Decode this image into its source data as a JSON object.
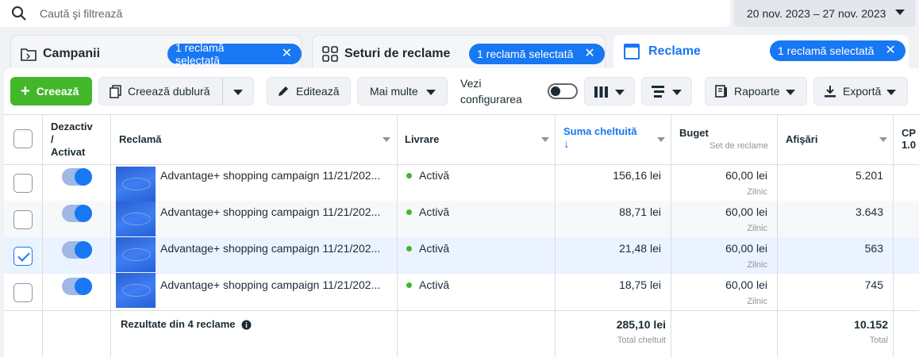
{
  "search": {
    "placeholder": "Caută şi filtrează"
  },
  "date_range": "20 nov. 2023 – 27 nov. 2023",
  "tabs": [
    {
      "label": "Campanii",
      "pill": "1 reclamă selectată"
    },
    {
      "label": "Seturi de reclame",
      "pill": "1 reclamă selectată"
    },
    {
      "label": "Reclame",
      "pill": "1 reclamă selectată"
    }
  ],
  "toolbar": {
    "create": "Creează",
    "duplicate": "Creează dublură",
    "edit": "Editează",
    "more": "Mai multe",
    "view_setup_line1": "Vezi",
    "view_setup_line2": "configurarea",
    "reports": "Rapoarte",
    "export": "Exportă"
  },
  "columns": {
    "status_l1": "Dezactiv",
    "status_l2": "/",
    "status_l3": "Activat",
    "ad": "Reclamă",
    "delivery": "Livrare",
    "spent": "Suma cheltuită",
    "spent_arrow": "↓",
    "budget": "Buget",
    "budget_sub": "Set de reclame",
    "impressions": "Afişări",
    "cpm_l1": "CP",
    "cpm_l2": "1.0"
  },
  "rows": [
    {
      "name": "Advantage+ shopping campaign 11/21/202...",
      "delivery": "Activă",
      "spent": "156,16 lei",
      "budget": "60,00 lei",
      "budget_period": "Zilnic",
      "impressions": "5.201",
      "checked": false
    },
    {
      "name": "Advantage+ shopping campaign 11/21/202...",
      "delivery": "Activă",
      "spent": "88,71 lei",
      "budget": "60,00 lei",
      "budget_period": "Zilnic",
      "impressions": "3.643",
      "checked": false
    },
    {
      "name": "Advantage+ shopping campaign 11/21/202...",
      "delivery": "Activă",
      "spent": "21,48 lei",
      "budget": "60,00 lei",
      "budget_period": "Zilnic",
      "impressions": "563",
      "checked": true
    },
    {
      "name": "Advantage+ shopping campaign 11/21/202...",
      "delivery": "Activă",
      "spent": "18,75 lei",
      "budget": "60,00 lei",
      "budget_period": "Zilnic",
      "impressions": "745",
      "checked": false
    }
  ],
  "totals": {
    "label": "Rezultate din 4 reclame",
    "spent": "285,10 lei",
    "spent_sub": "Total cheltuit",
    "impressions": "10.152",
    "impressions_sub": "Total"
  },
  "colors": {
    "accent": "#1877f2",
    "create": "#42b72a",
    "active_dot": "#42b72a"
  }
}
